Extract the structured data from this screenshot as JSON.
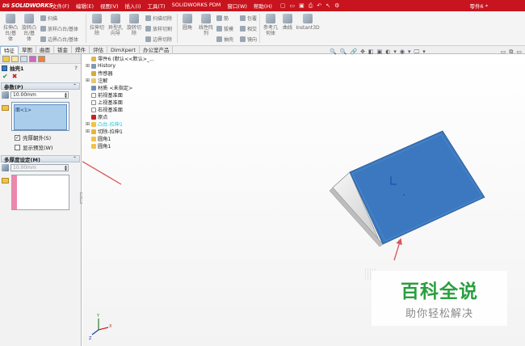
{
  "app": {
    "logo": "SOLIDWORKS",
    "logo_prefix": "DS",
    "menu": [
      "文件(F)",
      "编辑(E)",
      "视图(V)",
      "插入(I)",
      "工具(T)",
      "SOLIDWORKS PDM",
      "窗口(W)",
      "帮助(H)"
    ],
    "document_title": "零件6 *"
  },
  "ribbon": {
    "large": [
      {
        "label": "拉伸凸\n台/基\n体"
      },
      {
        "label": "旋转凸\n台/基\n体"
      },
      {
        "label": "拉伸切\n除"
      },
      {
        "label": "异型孔\n向导"
      },
      {
        "label": "旋转切\n除"
      },
      {
        "label": "圆角"
      },
      {
        "label": "线性阵\n列"
      },
      {
        "label": "参考几\n何体"
      },
      {
        "label": "曲线"
      },
      {
        "label": "Instant3D"
      }
    ],
    "small": [
      {
        "label": "扫描"
      },
      {
        "label": "放样凸台/基体"
      },
      {
        "label": "边界凸台/基体"
      },
      {
        "label": "扫描切除"
      },
      {
        "label": "放样切割"
      },
      {
        "label": "边界切除"
      },
      {
        "label": "筋"
      },
      {
        "label": "包覆"
      },
      {
        "label": "拔模"
      },
      {
        "label": "相交"
      },
      {
        "label": "抽壳"
      },
      {
        "label": "镜向"
      }
    ]
  },
  "tabs": [
    "特征",
    "草图",
    "曲面",
    "钣金",
    "焊件",
    "评估",
    "DimXpert",
    "办公室产品"
  ],
  "property_manager": {
    "title": "抽壳1",
    "help": "?",
    "ok": "✔",
    "cancel": "✖",
    "params_header": "参数(P)",
    "thickness": "10.00mm",
    "faces_item": "面<1>",
    "shell_outward": "壳厚朝外(S)",
    "shell_outward_checked": true,
    "show_preview": "显示预览(W)",
    "show_preview_checked": false,
    "multi_header": "多厚度设定(M)",
    "multi_thickness": "10.00mm",
    "splitter": "›"
  },
  "tree": [
    {
      "label": "零件6 (默认<<默认>_...",
      "plus": "",
      "icon": "part-icon"
    },
    {
      "label": "History",
      "plus": "⊞",
      "icon": "history-icon"
    },
    {
      "label": "传感器",
      "plus": "",
      "icon": "sensor-icon"
    },
    {
      "label": "注解",
      "plus": "⊞",
      "icon": "annotation-icon"
    },
    {
      "label": "材质 <未指定>",
      "plus": "",
      "icon": "material-icon"
    },
    {
      "label": "前视基准面",
      "plus": "",
      "icon": "plane-icon"
    },
    {
      "label": "上视基准面",
      "plus": "",
      "icon": "plane-icon"
    },
    {
      "label": "右视基准面",
      "plus": "",
      "icon": "plane-icon"
    },
    {
      "label": "原点",
      "plus": "",
      "icon": "origin-icon"
    },
    {
      "label": "凸台-拉伸1",
      "plus": "⊞",
      "icon": "extrude-icon",
      "preview": true
    },
    {
      "label": "切除-拉伸1",
      "plus": "⊞",
      "icon": "cut-icon"
    },
    {
      "label": "圆角1",
      "plus": "",
      "icon": "fillet-icon"
    },
    {
      "label": "圆角1",
      "plus": "",
      "icon": "fillet-icon"
    }
  ],
  "hud": [
    "🔍",
    "🔍",
    "🔗",
    "✥",
    "◧",
    "▣",
    "◐",
    "▾",
    "◉",
    "▾",
    "🖵",
    "▾"
  ],
  "window_buttons": [
    "▭",
    "⧉",
    "▭"
  ],
  "watermark": {
    "main": "百科全说",
    "sub": "助你轻松解决"
  },
  "colors": {
    "titlebar": "#c8141e",
    "face": "#3b78bf",
    "arrow": "#d8565a"
  }
}
